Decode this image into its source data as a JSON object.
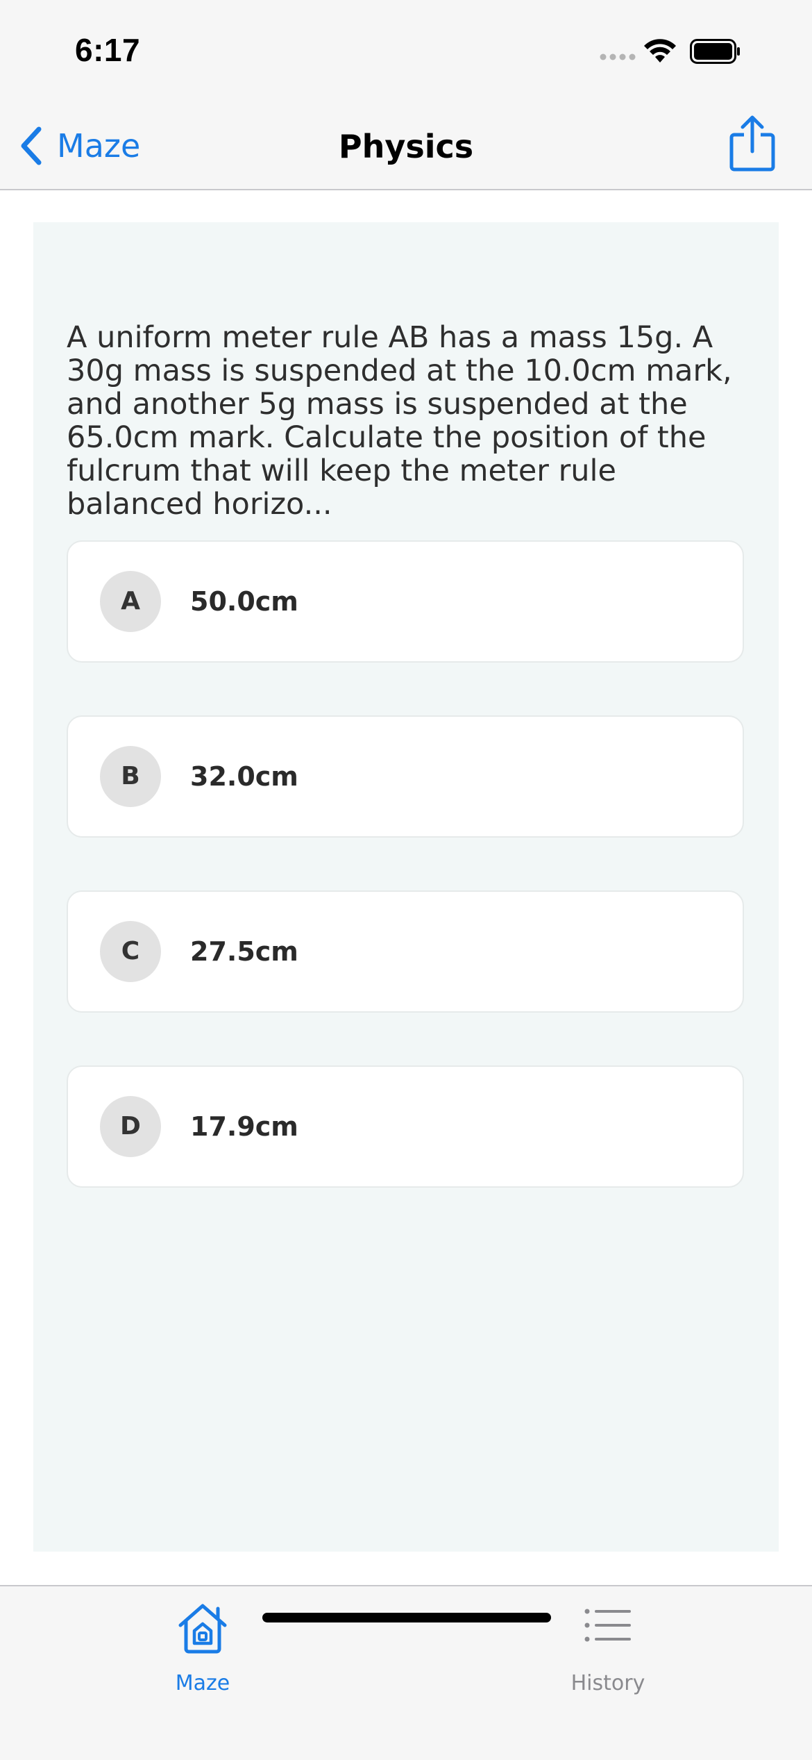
{
  "status_bar": {
    "time": "6:17",
    "icons": [
      "signal-icon",
      "wifi-icon",
      "battery-icon"
    ]
  },
  "nav": {
    "back_label": "Maze",
    "back_icon": "chevron-left-icon",
    "title": "Physics",
    "share_icon": "share-icon",
    "accent_color": "#1a7ce6"
  },
  "question": {
    "text": "A uniform meter rule AB has a mass 15g. A 30g mass is suspended at the 10.0cm mark, and another 5g mass is suspended at the 65.0cm mark. Calculate the position of the fulcrum that will keep the meter rule balanced horizo...",
    "options": [
      {
        "letter": "A",
        "text": "50.0cm"
      },
      {
        "letter": "B",
        "text": "32.0cm"
      },
      {
        "letter": "C",
        "text": "27.5cm"
      },
      {
        "letter": "D",
        "text": "17.9cm"
      }
    ]
  },
  "tab_bar": {
    "tabs": [
      {
        "label": "Maze",
        "icon": "home-icon",
        "selected": true
      },
      {
        "label": "History",
        "icon": "list-icon",
        "selected": false
      }
    ]
  }
}
